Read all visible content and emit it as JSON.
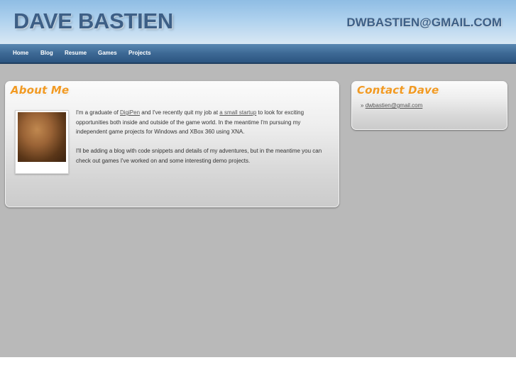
{
  "header": {
    "site_title": "DAVE BASTIEN",
    "email": "DWBASTIEN@GMAIL.COM"
  },
  "nav": {
    "items": [
      {
        "label": "Home"
      },
      {
        "label": "Blog"
      },
      {
        "label": "Resume"
      },
      {
        "label": "Games"
      },
      {
        "label": "Projects"
      }
    ]
  },
  "about": {
    "heading": "About Me",
    "p1_before": "I'm a graduate of ",
    "p1_link1": "DigiPen",
    "p1_mid": " and I've recently quit my job at ",
    "p1_link2": "a small startup",
    "p1_after": " to look for exciting opportunities both inside and outside of the game world. In the meantime I'm pursuing my independent game projects for Windows and XBox 360 using XNA.",
    "p2": "I'll be adding a blog with code snippets and details of my adventures, but in the meantime you can check out games I've worked on and some interesting demo projects."
  },
  "contact": {
    "heading": "Contact Dave",
    "bullet": "»",
    "email": "dwbastien@gmail.com"
  },
  "colors": {
    "heading_orange": "#f19a23",
    "title_blue": "#3d5f86",
    "nav_blue": "#3d6995",
    "background_gray": "#b9b9b9"
  }
}
